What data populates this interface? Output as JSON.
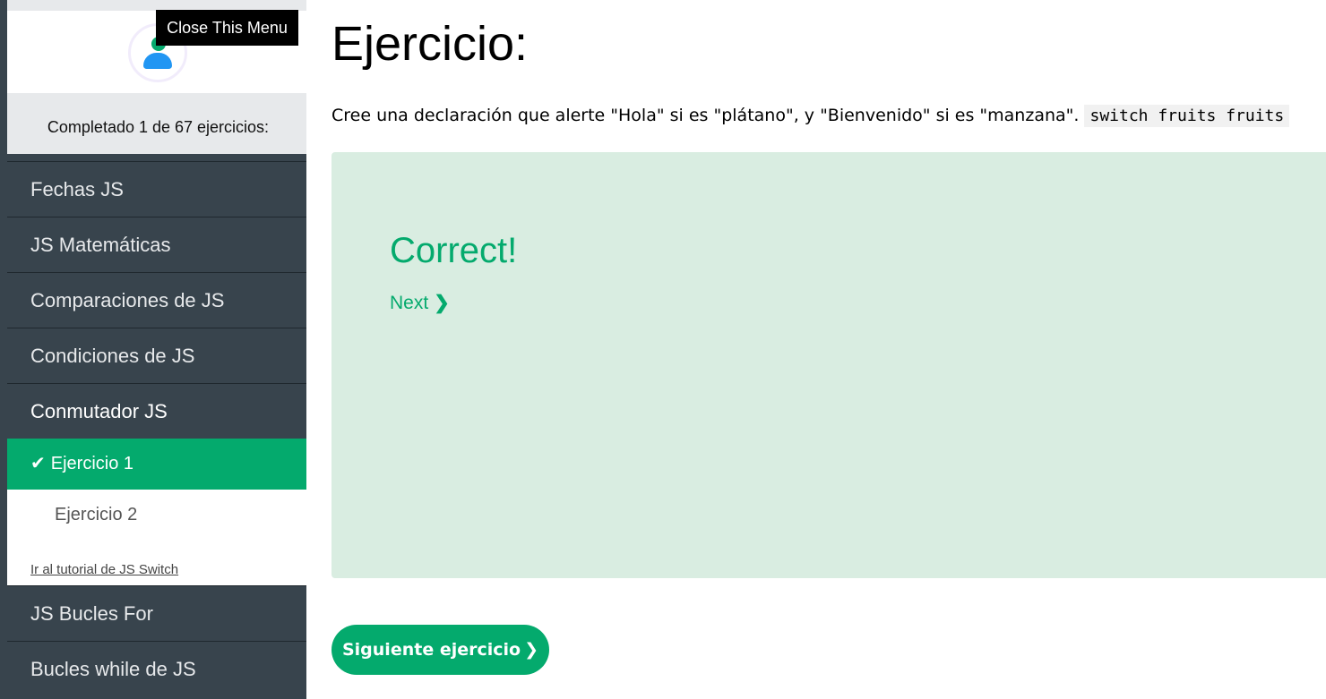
{
  "sidebar": {
    "close_menu_label": "Close This Menu",
    "progress_text": "Completado 1 de 67 ejercicios:",
    "items": [
      {
        "label": "Fechas JS"
      },
      {
        "label": "JS Matemáticas"
      },
      {
        "label": "Comparaciones de JS"
      },
      {
        "label": "Condiciones de JS"
      },
      {
        "label": "Conmutador JS"
      }
    ],
    "sub_items": [
      {
        "label": "Ejercicio 1",
        "status": "completed"
      },
      {
        "label": "Ejercicio 2",
        "status": "pending"
      }
    ],
    "tutorial_link": "Ir al tutorial de JS Switch",
    "items_after": [
      {
        "label": "JS Bucles For"
      },
      {
        "label": "Bucles while de JS"
      }
    ]
  },
  "main": {
    "title": "Ejercicio:",
    "instruction_text": "Cree una declaración que alerte \"Hola\" si es \"plátano\", y \"Bienvenido\" si es \"manzana\".",
    "instruction_code": "switch fruits fruits",
    "result_title": "Correct!",
    "next_label": "Next",
    "next_exercise_label": "Siguiente ejercicio"
  },
  "icons": {
    "avatar": "user-avatar-icon",
    "check": "checkmark-icon",
    "chevron": "chevron-right-icon"
  },
  "colors": {
    "accent_green": "#04aa6d",
    "sidebar_bg": "#38444d",
    "result_bg": "#d9ede1"
  }
}
